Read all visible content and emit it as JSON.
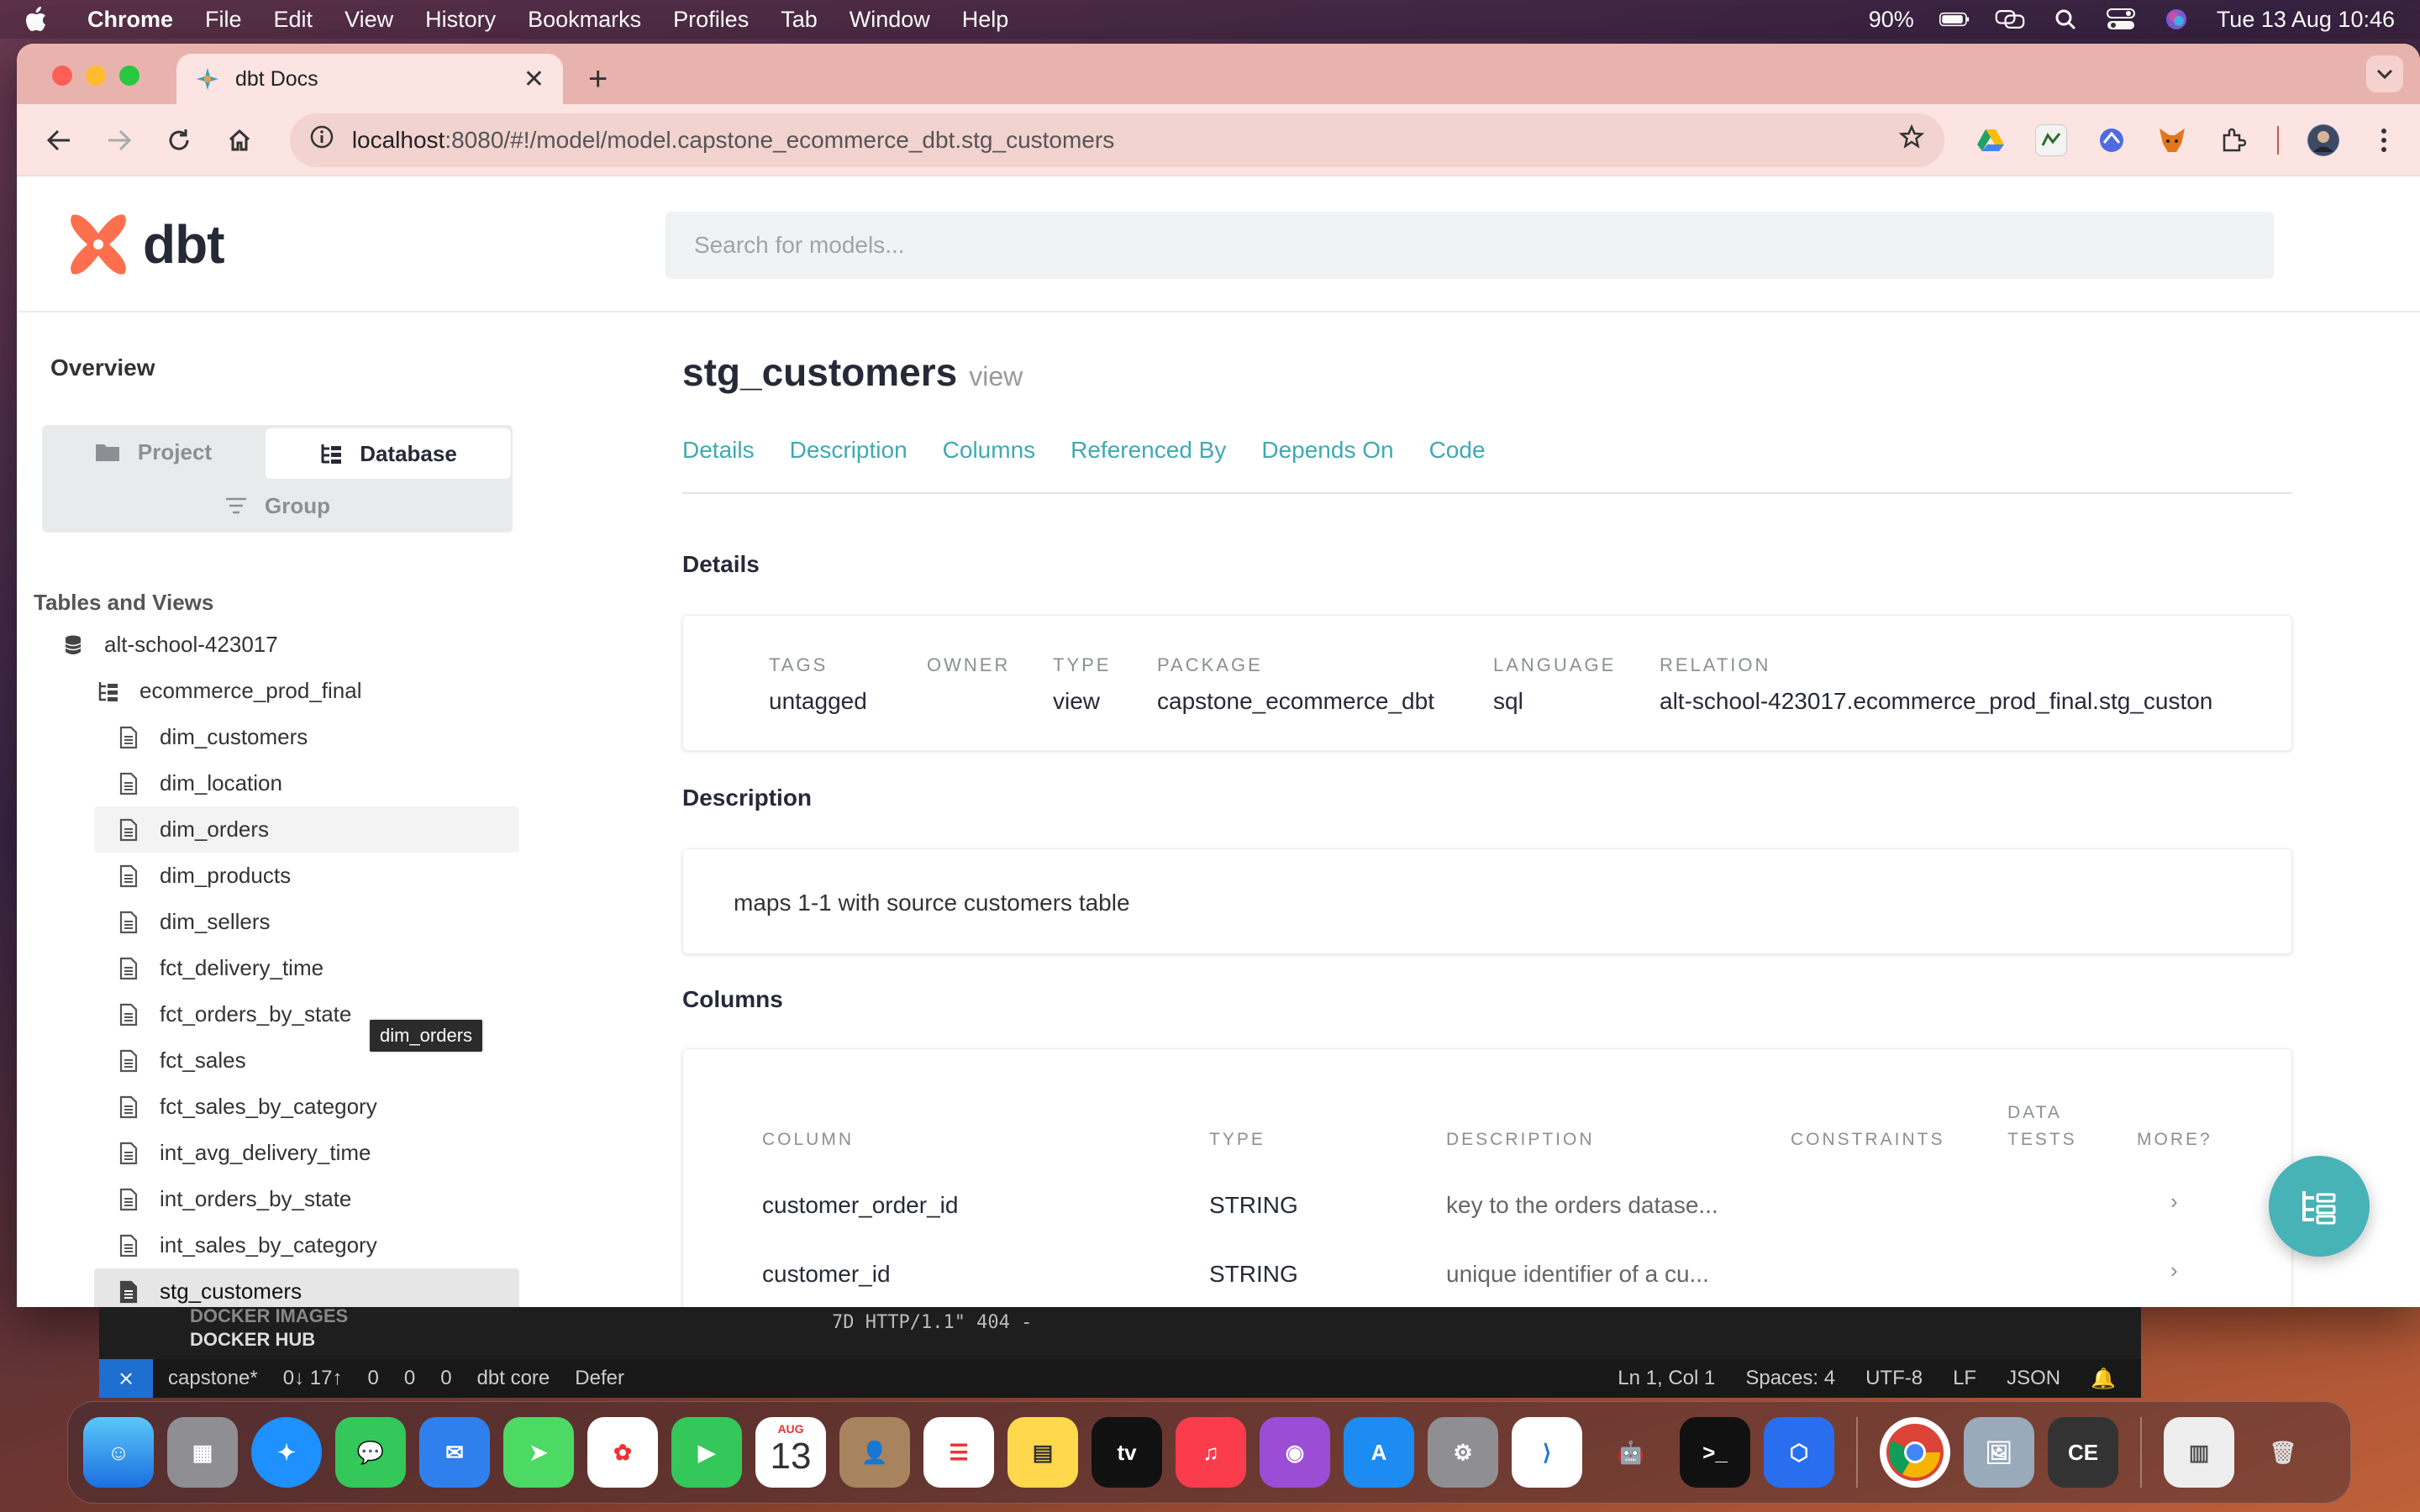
{
  "menubar": {
    "app": "Chrome",
    "items": [
      "File",
      "Edit",
      "View",
      "History",
      "Bookmarks",
      "Profiles",
      "Tab",
      "Window",
      "Help"
    ],
    "battery": "90%",
    "datetime": "Tue 13 Aug  10:46"
  },
  "browser": {
    "tab_title": "dbt Docs",
    "url_host": "localhost",
    "url_path": ":8080/#!/model/model.capstone_ecommerce_dbt.stg_customers"
  },
  "header": {
    "logo_text": "dbt",
    "search_placeholder": "Search for models..."
  },
  "sidebar": {
    "overview": "Overview",
    "seg_project": "Project",
    "seg_database": "Database",
    "seg_group": "Group",
    "section_title": "Tables and Views",
    "database": "alt-school-423017",
    "schema": "ecommerce_prod_final",
    "models": [
      "dim_customers",
      "dim_location",
      "dim_orders",
      "dim_products",
      "dim_sellers",
      "fct_delivery_time",
      "fct_orders_by_state",
      "fct_sales",
      "fct_sales_by_category",
      "int_avg_delivery_time",
      "int_orders_by_state",
      "int_sales_by_category",
      "stg_customers"
    ],
    "tooltip": "dim_orders"
  },
  "main": {
    "title": "stg_customers",
    "kind": "view",
    "nav": [
      "Details",
      "Description",
      "Columns",
      "Referenced By",
      "Depends On",
      "Code"
    ],
    "details_title": "Details",
    "details": {
      "tags_label": "TAGS",
      "tags": "untagged",
      "owner_label": "OWNER",
      "owner": "",
      "type_label": "TYPE",
      "type": "view",
      "package_label": "PACKAGE",
      "package": "capstone_ecommerce_dbt",
      "language_label": "LANGUAGE",
      "language": "sql",
      "relation_label": "RELATION",
      "relation": "alt-school-423017.ecommerce_prod_final.stg_custon"
    },
    "description_title": "Description",
    "description": "maps 1-1 with source customers table",
    "columns_title": "Columns",
    "columns_headers": {
      "column": "COLUMN",
      "type": "TYPE",
      "description": "DESCRIPTION",
      "constraints": "CONSTRAINTS",
      "data_tests_1": "DATA",
      "data_tests_2": "TESTS",
      "more": "MORE?"
    },
    "columns": [
      {
        "name": "customer_order_id",
        "type": "STRING",
        "description": "key to the orders datase..."
      },
      {
        "name": "customer_id",
        "type": "STRING",
        "description": "unique identifier of a cu..."
      }
    ]
  },
  "vscode": {
    "docker_images": "DOCKER IMAGES",
    "docker_hub": "DOCKER HUB",
    "terminal_line": "7D HTTP/1.1\" 404 -",
    "branch": "capstone*",
    "sync": "0↓ 17↑",
    "problems": "0",
    "warnings": "0",
    "ports": "0",
    "dbt": "dbt core",
    "defer": "Defer",
    "position": "Ln 1, Col 1",
    "spaces": "Spaces: 4",
    "encoding": "UTF-8",
    "eol": "LF",
    "language": "JSON"
  },
  "dock": {
    "calendar_month": "AUG",
    "calendar_day": "13"
  }
}
